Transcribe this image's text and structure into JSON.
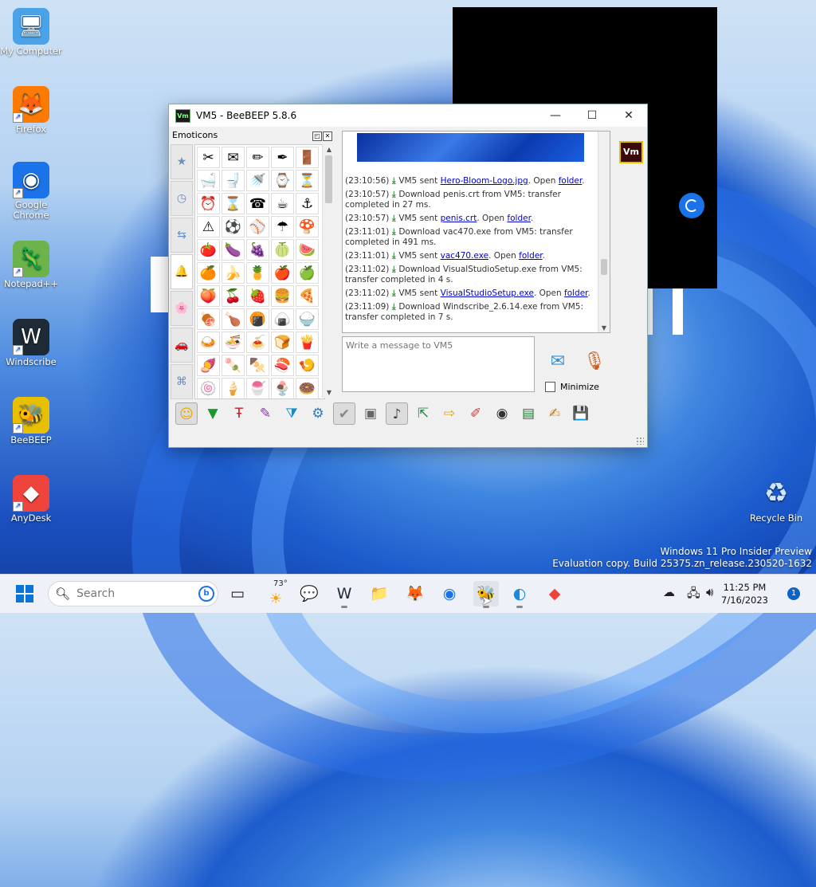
{
  "desktop": {
    "icons": [
      {
        "label": "My Computer",
        "glyph": "🖥",
        "color": "#4aa3e8",
        "shortcut": false
      },
      {
        "label": "Firefox",
        "glyph": "🦊",
        "color": "#ff7a00",
        "shortcut": true
      },
      {
        "label": "Google Chrome",
        "glyph": "◉",
        "color": "#1a73e8",
        "shortcut": true
      },
      {
        "label": "Notepad++",
        "glyph": "🦎",
        "color": "#6bb34a",
        "shortcut": true
      },
      {
        "label": "Windscribe",
        "glyph": "W",
        "color": "#1e2a36",
        "shortcut": true
      },
      {
        "label": "BeeBEEP",
        "glyph": "🐝",
        "color": "#e8c000",
        "shortcut": true
      },
      {
        "label": "AnyDesk",
        "glyph": "◆",
        "color": "#ef443b",
        "shortcut": true
      }
    ],
    "recycle_bin": {
      "label": "Recycle Bin",
      "glyph": "♻"
    }
  },
  "window": {
    "logo": "Vm",
    "title": "VM5 - BeeBEEP 5.8.6",
    "minimize": "—",
    "maximize": "☐",
    "close": "✕"
  },
  "emoticons": {
    "header": "Emoticons",
    "tabs": [
      "★",
      "◷",
      "⇆",
      "🔔",
      "🌸",
      "🚗",
      "⌘"
    ],
    "cells": [
      "✂",
      "✉",
      "✏",
      "✒",
      "🚪",
      "🛁",
      "🚽",
      "🚿",
      "⌚",
      "⏳",
      "⏰",
      "⌛",
      "☎",
      "☕",
      "⚓",
      "⚠",
      "⚽",
      "⚾",
      "☂",
      "🍄",
      "🍅",
      "🍆",
      "🍇",
      "🍈",
      "🍉",
      "🍊",
      "🍌",
      "🍍",
      "🍎",
      "🍏",
      "🍑",
      "🍒",
      "🍓",
      "🍔",
      "🍕",
      "🍖",
      "🍗",
      "🍘",
      "🍙",
      "🍚",
      "🍛",
      "🍜",
      "🍝",
      "🍞",
      "🍟",
      "🍠",
      "🍡",
      "🍢",
      "🍣",
      "🍤",
      "🍥",
      "🍦",
      "🍧",
      "🍨",
      "🍩"
    ]
  },
  "chat": {
    "log": [
      {
        "time": "(23:10:56)",
        "pre": "VM5 sent ",
        "link": "Hero-Bloom-Logo.jpg",
        "mid": ". Open ",
        "link2": "folder",
        "post": "."
      },
      {
        "time": "(23:10:57)",
        "pre": "Download penis.crt from VM5: transfer completed in 27 ms.",
        "link": "",
        "mid": "",
        "link2": "",
        "post": ""
      },
      {
        "time": "(23:10:57)",
        "pre": "VM5 sent ",
        "link": "penis.crt",
        "mid": ". Open ",
        "link2": "folder",
        "post": "."
      },
      {
        "time": "(23:11:01)",
        "pre": "Download vac470.exe from VM5: transfer completed in 491 ms.",
        "link": "",
        "mid": "",
        "link2": "",
        "post": ""
      },
      {
        "time": "(23:11:01)",
        "pre": "VM5 sent ",
        "link": "vac470.exe",
        "mid": ". Open ",
        "link2": "folder",
        "post": "."
      },
      {
        "time": "(23:11:02)",
        "pre": "Download VisualStudioSetup.exe from VM5: transfer completed in 4 s.",
        "link": "",
        "mid": "",
        "link2": "",
        "post": ""
      },
      {
        "time": "(23:11:02)",
        "pre": "VM5 sent ",
        "link": "VisualStudioSetup.exe",
        "mid": ". Open ",
        "link2": "folder",
        "post": "."
      },
      {
        "time": "(23:11:09)",
        "pre": "Download Windscribe_2.6.14.exe from VM5: transfer completed in 7 s.",
        "link": "",
        "mid": "",
        "link2": "",
        "post": ""
      }
    ],
    "input_placeholder": "Write a message to VM5",
    "minimize_label": "Minimize",
    "user_badge": "Vm"
  },
  "toolbar": [
    "☺",
    "▼",
    "Ŧ",
    "✎",
    "⧩",
    "⚙",
    "✔",
    "▣",
    "♪",
    "⇱",
    "⇨",
    "✐",
    "◉",
    "▤",
    "✍",
    "💾"
  ],
  "watermark": {
    "line1": "Windows 11 Pro Insider Preview",
    "line2": "Evaluation copy. Build 25375.zn_release.230520-1632"
  },
  "taskbar": {
    "search_placeholder": "Search",
    "bing": "b",
    "weather_temp": "73°",
    "apps": [
      {
        "name": "task-view",
        "glyph": "▭"
      },
      {
        "name": "teams",
        "glyph": "💬"
      },
      {
        "name": "windscribe",
        "glyph": "W"
      },
      {
        "name": "file-explorer",
        "glyph": "📁"
      },
      {
        "name": "firefox",
        "glyph": "🦊"
      },
      {
        "name": "chrome",
        "glyph": "◉"
      },
      {
        "name": "beebeep",
        "glyph": "🐝"
      },
      {
        "name": "edge",
        "glyph": "◐"
      },
      {
        "name": "anydesk",
        "glyph": "◆"
      }
    ],
    "time": "11:25 PM",
    "date": "7/16/2023",
    "notifications": "1"
  }
}
